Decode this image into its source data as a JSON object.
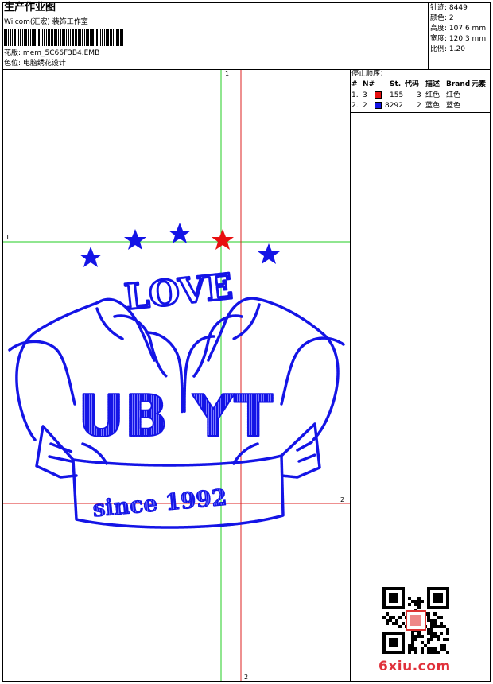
{
  "header": {
    "title": "生产作业图",
    "designer": "Wilcom(汇宏) 装饰工作室",
    "pattern_label": "花版",
    "pattern_value": "mem_5C66F3B4.EMB",
    "position_label": "色位",
    "position_value": "电脑绣花设计"
  },
  "stats": [
    {
      "label": "针迹",
      "value": "8449"
    },
    {
      "label": "颜色",
      "value": "2"
    },
    {
      "label": "高度",
      "value": "107.6 mm"
    },
    {
      "label": "宽度",
      "value": "120.3 mm"
    },
    {
      "label": "比例",
      "value": "1.20"
    }
  ],
  "stop_sequence": {
    "title": "停止顺序：",
    "columns": [
      "#",
      "N#",
      "St.",
      "代码",
      "描述",
      "Brand",
      "元素"
    ],
    "rows": [
      {
        "index": "1.",
        "needle": "3",
        "color": "#e81010",
        "stitches": "155",
        "code": "3",
        "description": "红色",
        "brand": "红色"
      },
      {
        "index": "2.",
        "needle": "2",
        "color": "#1414e6",
        "stitches": "8292",
        "code": "2",
        "description": "蓝色",
        "brand": "蓝色"
      }
    ]
  },
  "axis_labels": {
    "v_top": "1",
    "h_left": "1",
    "h_right": "2",
    "v_bottom": "2"
  },
  "design": {
    "top_text": "LOVE",
    "left_letters": "UB",
    "right_letters": "YT",
    "ribbon_text": "since 1992",
    "primary_color": "#1414e6",
    "accent_color": "#e81010"
  },
  "watermark": "6xiu.com",
  "guide_colors": {
    "green": "#22cc22",
    "red": "#dd2222"
  }
}
